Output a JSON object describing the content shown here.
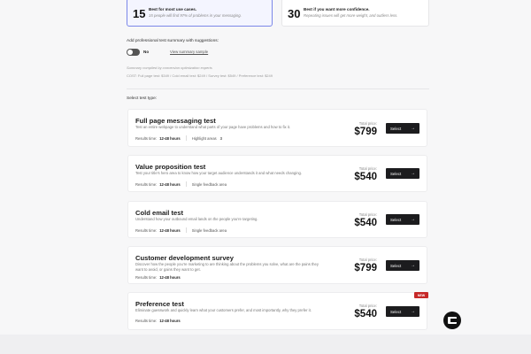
{
  "audience": {
    "selected": {
      "number": "15",
      "headline": "Best for most use cases.",
      "sub": "15 people will find 97% of problems in your messaging."
    },
    "other": {
      "number": "30",
      "headline": "Best if you want more confidence.",
      "sub": "Repeating issues will get more weight, and outliers less."
    }
  },
  "summary": {
    "heading": "Add professional test summary with suggestions:",
    "toggle_label": "No",
    "link": "View summary sample",
    "note": "Summary compiled by conversion optimization experts",
    "costs": "COST:   Full page test: $349  /  Cold email test: $249  /  Survey test: $549  /  Preference test: $249"
  },
  "select_heading": "Select test type:",
  "tests": [
    {
      "title": "Full page messaging test",
      "desc": "Test an entire webpage to understand what parts of your page have problems and how to fix it.",
      "results_label": "Results time:",
      "results_time": "12-48 hours",
      "extra": "Highlight areas",
      "extra_count": "3",
      "price_label": "Total price:",
      "price": "$799",
      "button": "Select",
      "arrow": "→"
    },
    {
      "title": "Value proposition test",
      "desc": "Test your title’s hero area to know how your target audience understands it and what needs changing.",
      "results_label": "Results time:",
      "results_time": "12-48 hours",
      "extra": "Single feedback area",
      "price_label": "Total price:",
      "price": "$540",
      "button": "Select",
      "arrow": "→"
    },
    {
      "title": "Cold email test",
      "desc": "Understand how your outbound email lands on the people you’re targeting.",
      "results_label": "Results time:",
      "results_time": "12-48 hours",
      "extra": "Single feedback area",
      "price_label": "Total price:",
      "price": "$540",
      "button": "Select",
      "arrow": "→"
    },
    {
      "title": "Customer development survey",
      "desc": "Discover how the people you’re marketing to are thinking about the problems you solve, what are the pains they want to avoid, or gains they want to get.",
      "results_label": "Results time:",
      "results_time": "12-48 hours",
      "price_label": "Total price:",
      "price": "$799",
      "button": "Select",
      "arrow": "→"
    },
    {
      "title": "Preference test",
      "desc": "Eliminate guesswork and quickly learn what your customers prefer, and most importantly, why they prefer it.",
      "results_label": "Results time:",
      "results_time": "12-48 hours",
      "price_label": "Total price:",
      "price": "$540",
      "button": "Select",
      "arrow": "→",
      "badge": "NEW"
    }
  ],
  "colors": {
    "accent": "#7b87e8",
    "button": "#1c1c1e",
    "badge": "#c62828"
  },
  "icons": {
    "chat": "chat-bubble-icon",
    "arrow": "arrow-right-icon"
  }
}
